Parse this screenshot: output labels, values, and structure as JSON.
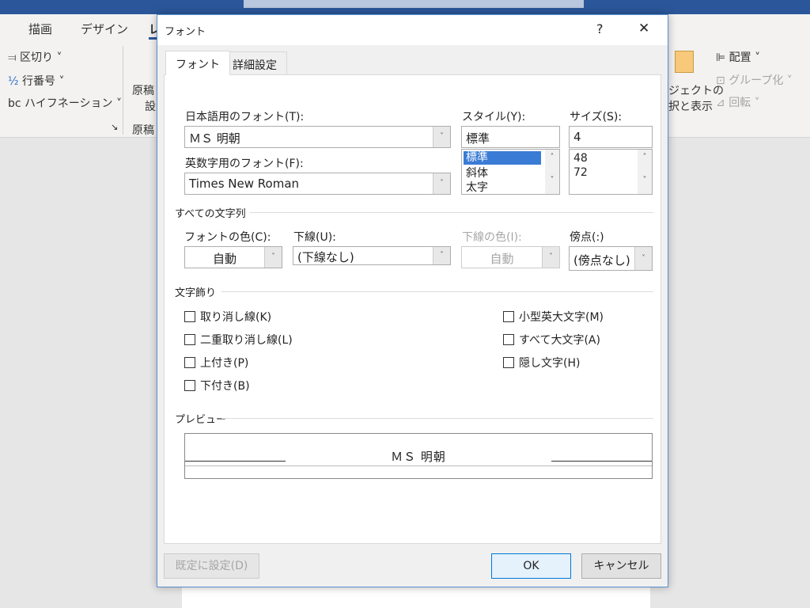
{
  "ribbon": {
    "tabs": [
      "描画",
      "デザイン",
      "レ"
    ],
    "items": {
      "breaks": "区切り",
      "line_numbers": "行番号",
      "hyphenation": "ハイフネーション",
      "manuscript1": "原稿",
      "manuscript2": "設",
      "manuscript_group": "原稿",
      "selection_pane1": "ジェクトの",
      "selection_pane2": "択と表示",
      "align": "配置",
      "group": "グループ化",
      "rotate": "回転"
    }
  },
  "dialog": {
    "title": "フォント",
    "help": "?",
    "close": "✕",
    "tabs": [
      "フォント",
      "詳細設定"
    ],
    "jp_font_label": "日本語用のフォント(T):",
    "jp_font_value": "ＭＳ 明朝",
    "en_font_label": "英数字用のフォント(F):",
    "en_font_value": "Times New Roman",
    "style_label": "スタイル(Y):",
    "style_value": "標準",
    "style_options": [
      "標準",
      "斜体",
      "太字"
    ],
    "size_label": "サイズ(S):",
    "size_value": "4",
    "size_options": [
      "48",
      "72"
    ],
    "all_text_section": "すべての文字列",
    "font_color_label": "フォントの色(C):",
    "font_color_value": "自動",
    "underline_label": "下線(U):",
    "underline_value": "(下線なし)",
    "underline_color_label": "下線の色(I):",
    "underline_color_value": "自動",
    "emphasis_label": "傍点(:)",
    "emphasis_value": "(傍点なし)",
    "effects_section": "文字飾り",
    "effects_left": [
      "取り消し線(K)",
      "二重取り消し線(L)",
      "上付き(P)",
      "下付き(B)"
    ],
    "effects_right": [
      "小型英大文字(M)",
      "すべて大文字(A)",
      "隠し文字(H)"
    ],
    "preview_section": "プレビュー",
    "preview_text": "ＭＳ 明朝",
    "default_button": "既定に設定(D)",
    "ok_button": "OK",
    "cancel_button": "キャンセル"
  }
}
